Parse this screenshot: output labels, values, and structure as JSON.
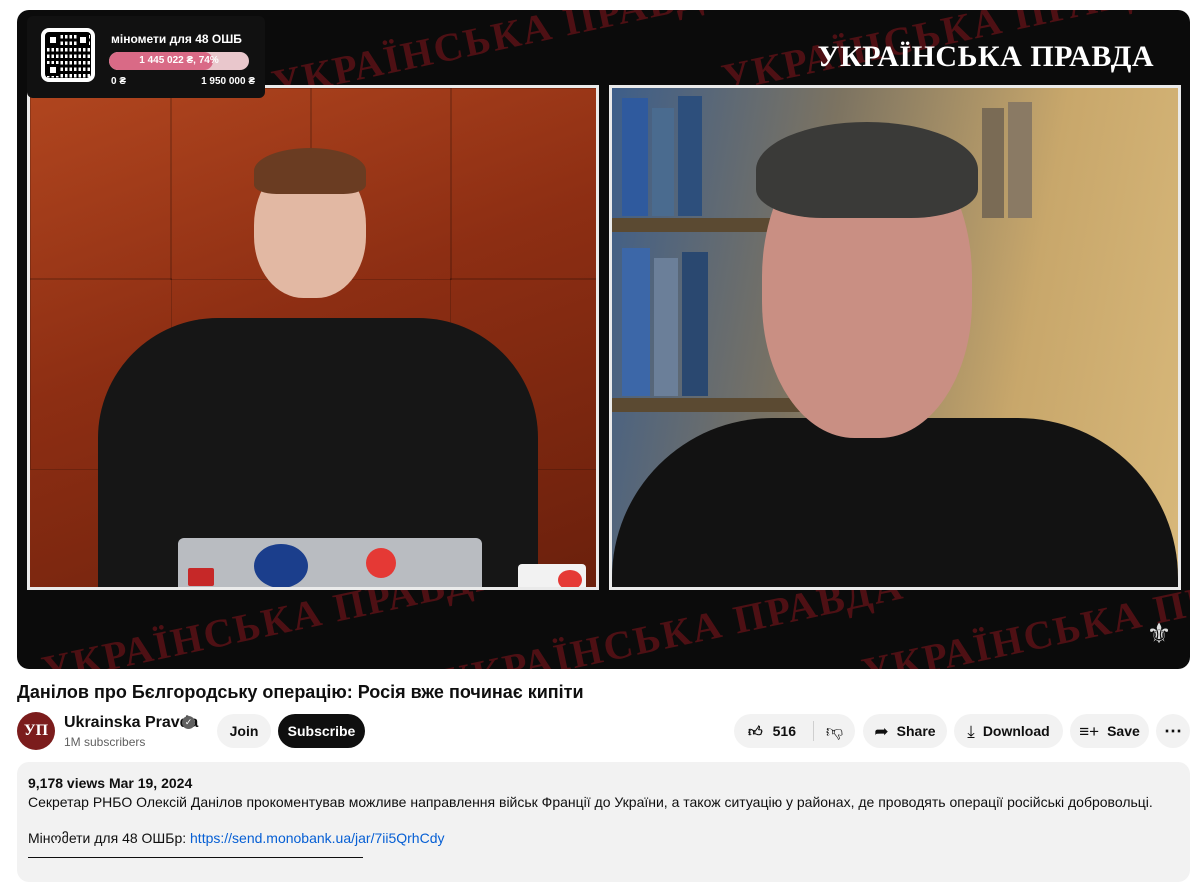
{
  "player": {
    "donation": {
      "title": "міномети для 48 ОШБ",
      "progress_text": "1 445 022 ₴, 74%",
      "progress_fraction": 0.74,
      "min_label": "0 ₴",
      "max_label": "1 950 000 ₴"
    },
    "brand": "УКРАЇНСЬКА ПРАВДА",
    "watermark_text": "УКРАЇНСЬКА ПРАВДА"
  },
  "video": {
    "title": "Данілов про Бєлгородську операцію: Росія вже починає кипіти"
  },
  "channel": {
    "avatar_text": "УП",
    "name": "Ukrainska Pravda",
    "subscribers": "1M subscribers",
    "join_label": "Join",
    "subscribe_label": "Subscribe"
  },
  "actions": {
    "like_count": "516",
    "share_label": "Share",
    "download_label": "Download",
    "save_label": "Save",
    "more_label": "⋯"
  },
  "description": {
    "meta": "9,178 views  Mar 19, 2024",
    "text": "Секретар РНБО Олексій Данілов прокоментував можливе направлення військ Франції до України, а також ситуацію у районах, де проводять операції російські добровольці.",
    "link_prefix": "Мінომети для 48 ОШБр: ",
    "link_url": "https://send.monobank.ua/jar/7ii5QrhCdy"
  },
  "colors": {
    "channel_avatar": "#7b1c1c",
    "link": "#065fd4",
    "watermark": "#5a1216"
  }
}
